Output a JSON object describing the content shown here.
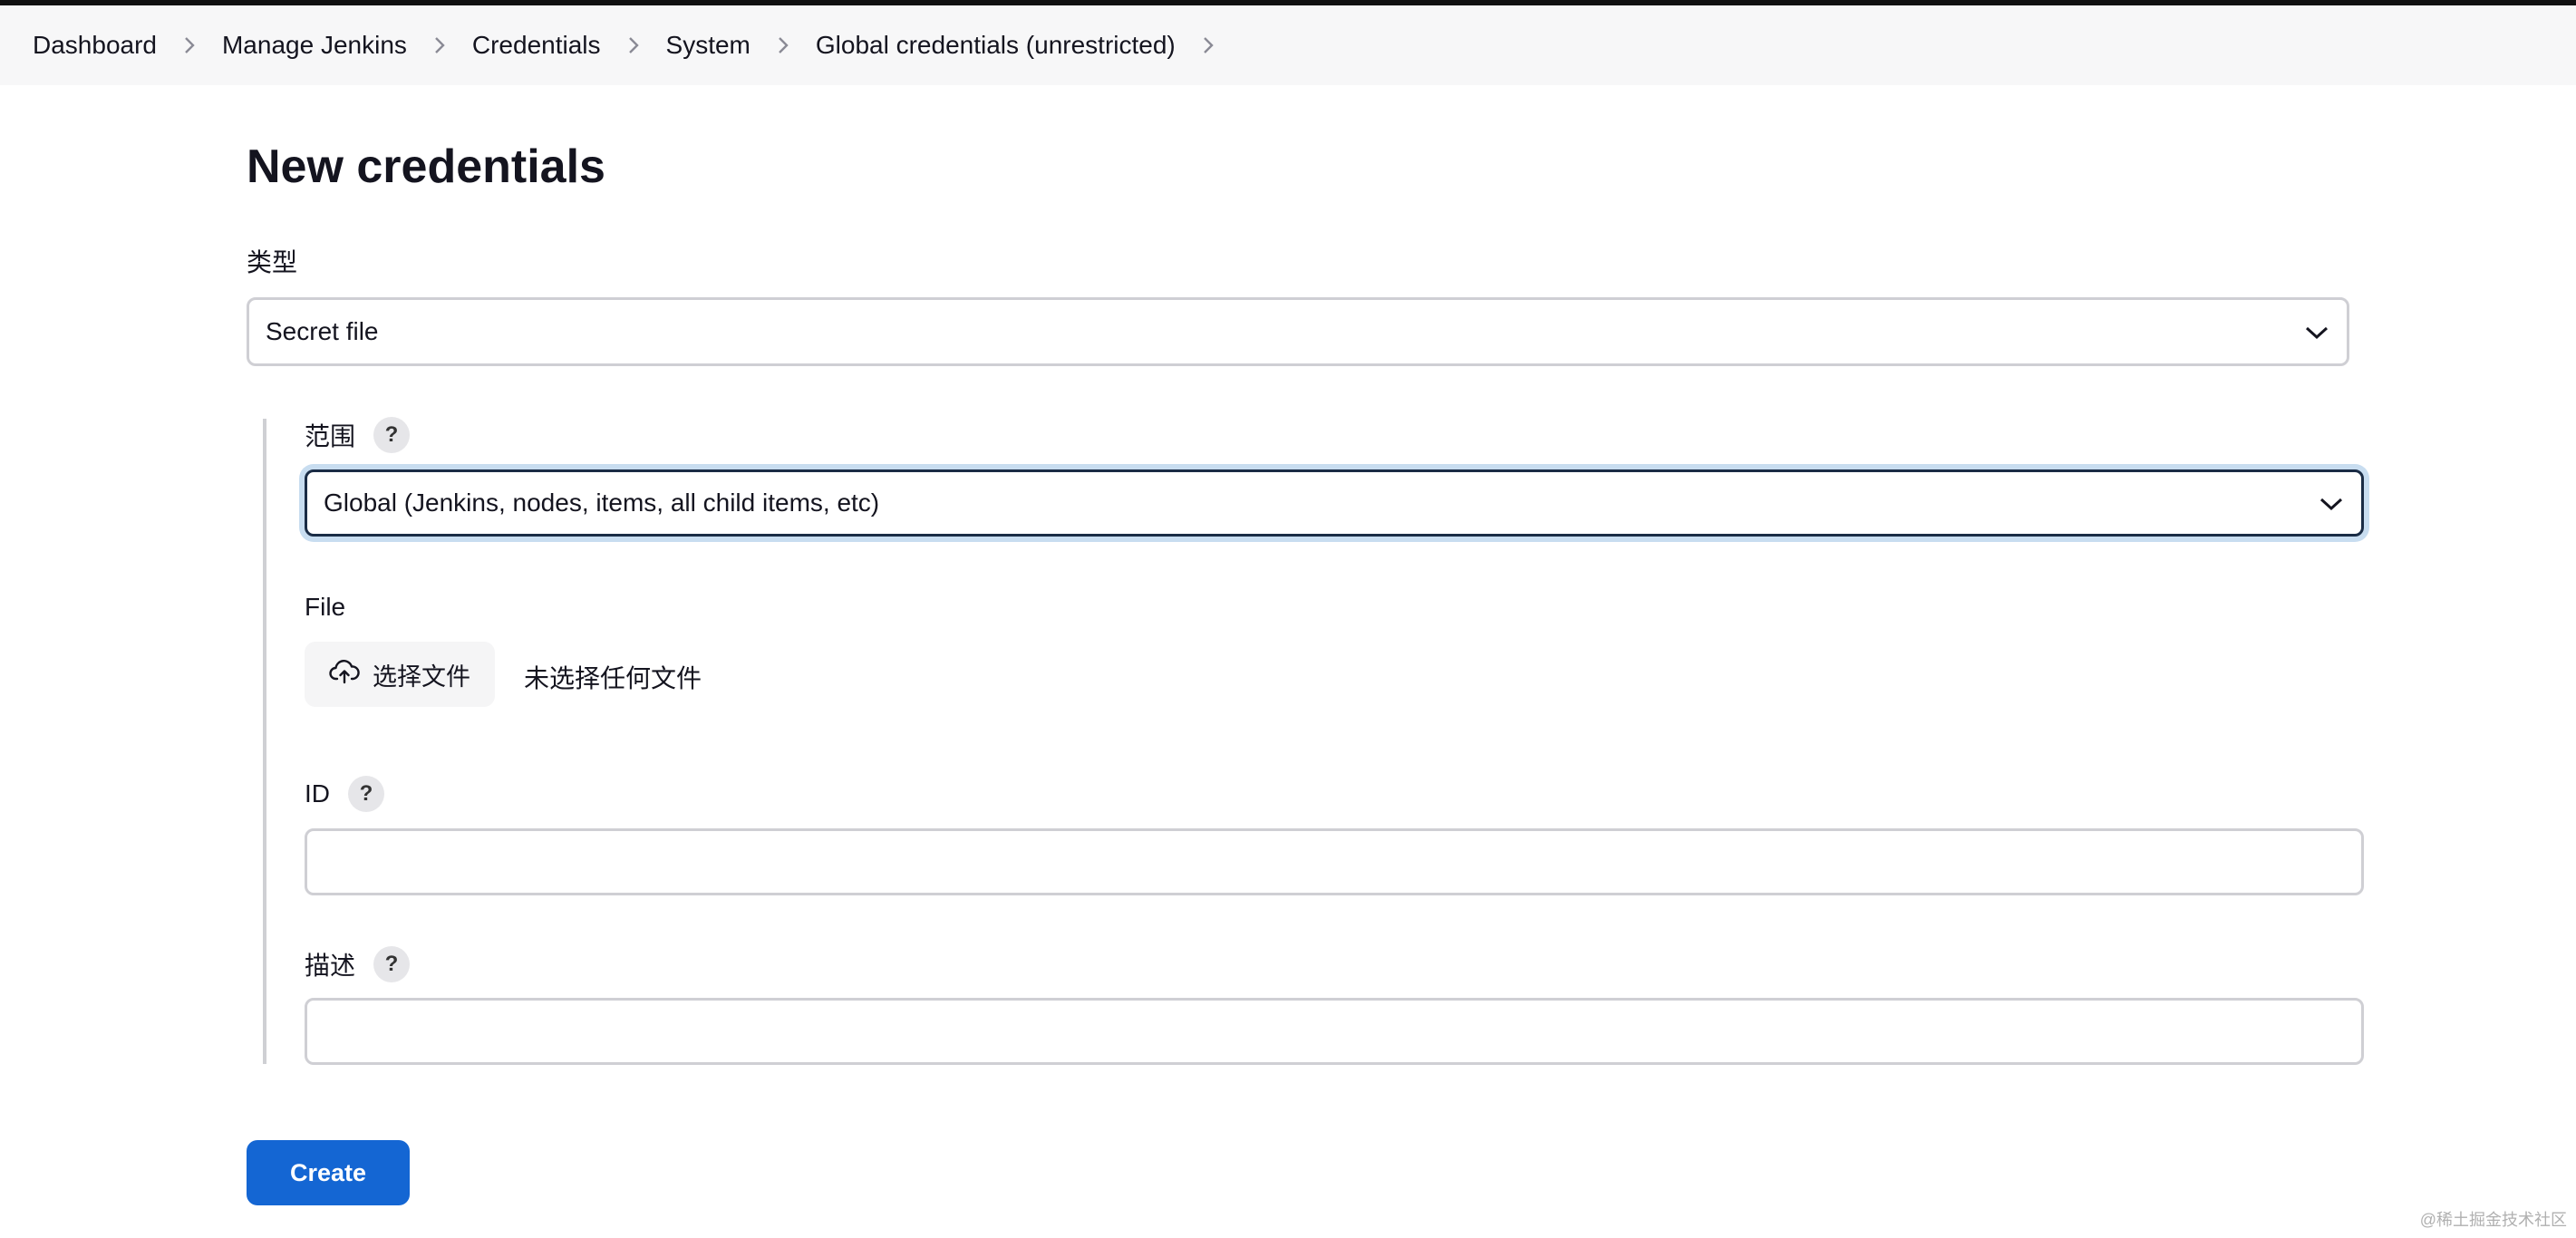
{
  "breadcrumb": {
    "items": [
      {
        "label": "Dashboard"
      },
      {
        "label": "Manage Jenkins"
      },
      {
        "label": "Credentials"
      },
      {
        "label": "System"
      },
      {
        "label": "Global credentials (unrestricted)"
      }
    ]
  },
  "page": {
    "title": "New credentials"
  },
  "form": {
    "kind": {
      "label": "类型",
      "selected": "Secret file"
    },
    "scope": {
      "label": "范围",
      "help": "?",
      "selected": "Global (Jenkins, nodes, items, all child items, etc)"
    },
    "file": {
      "label": "File",
      "button_label": "选择文件",
      "status": "未选择任何文件",
      "icon": "cloud-upload-icon"
    },
    "id": {
      "label": "ID",
      "help": "?",
      "value": ""
    },
    "description": {
      "label": "描述",
      "help": "?",
      "value": ""
    },
    "submit_label": "Create"
  },
  "watermark": "@稀土掘金技术社区",
  "colors": {
    "primary_button": "#1466d3",
    "focus_ring": "#c8ddf0",
    "focus_border": "#1a2c45",
    "breadcrumb_bg": "#f7f7f8"
  }
}
